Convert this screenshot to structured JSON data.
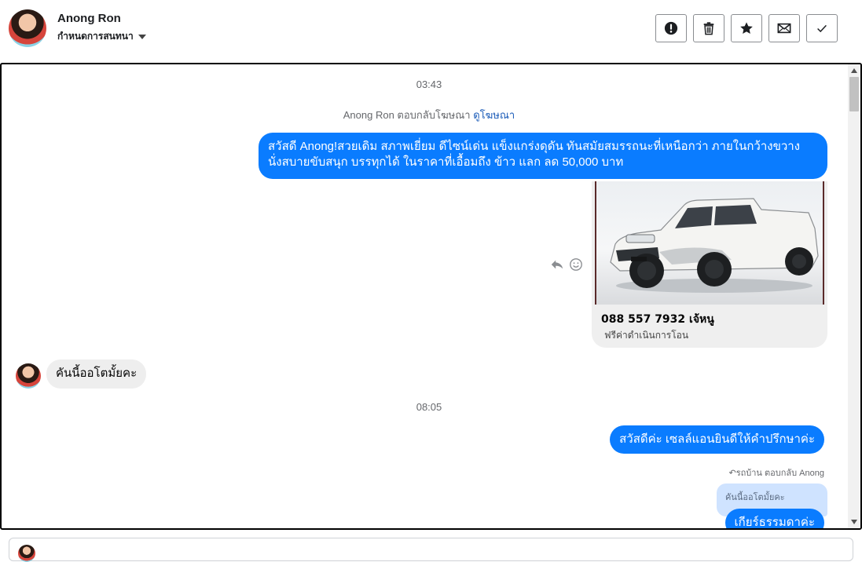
{
  "header": {
    "contact_name": "Anong Ron",
    "label_select": "กำหนดการสนทนา"
  },
  "actions": [
    {
      "name": "spam-button",
      "icon": "exclamation-icon"
    },
    {
      "name": "delete-button",
      "icon": "trash-icon"
    },
    {
      "name": "star-button",
      "icon": "star-icon"
    },
    {
      "name": "mark-unread-button",
      "icon": "envelope-icon"
    },
    {
      "name": "mark-done-button",
      "icon": "check-icon"
    }
  ],
  "conversation": {
    "time_1": "03:43",
    "ad_reply_prefix": "Anong Ron ตอบกลับโฆษณา",
    "ad_reply_link": "ดูโฆษณา",
    "outgoing_1_line1": "สวัสดี Anong!สวยเดิม สภาพเยี่ยม ดีไซน์เด่น แข็งแกร่งดุดัน ทันสมัยสมรรถนะที่เหนือกว่า ภายในกว้างขวาง",
    "outgoing_1_line2": "นั่งสบายขับสนุก บรรทุกได้ ในราคาที่เอื้อมถึง  ข้าว แลก ลด 50,000 บาท",
    "ad_card_title": "088 557 7932 เจ้หนู",
    "ad_card_subtitle": "ฟรีค่าดำเนินการโอน",
    "incoming_1": "คันนี้ออโตมั้ยคะ",
    "time_2": "08:05",
    "outgoing_2": "สวัสดีค่ะ เซลล์แอนยินดีให้คำปรึกษาค่ะ",
    "reply_note": "รถบ้าน ตอบกลับ Anong",
    "quoted_text": "คันนี้ออโตมั้ยคะ",
    "outgoing_3": "เกียร์ธรรมดาค่ะ"
  },
  "colors": {
    "outgoing_bubble": "#0a7cff",
    "incoming_bubble": "#eeeeee",
    "link": "#1a5bb8"
  }
}
